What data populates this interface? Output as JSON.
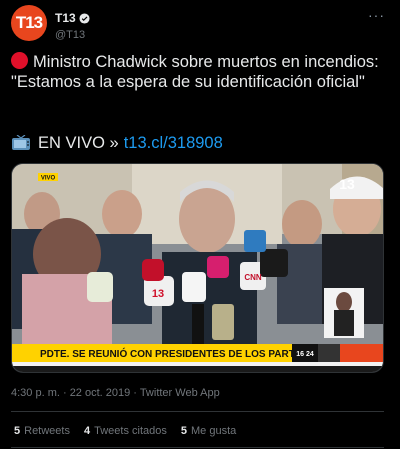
{
  "account": {
    "avatar_text": "T13",
    "display_name": "T13",
    "handle": "@T13",
    "brand_color": "#e8461e"
  },
  "tweet": {
    "text": "Ministro Chadwick sobre muertos en incendios: \"Estamos a la espera de su identificación oficial\"",
    "live_label": "EN VIVO »",
    "link": "t13.cl/318908"
  },
  "media": {
    "live_badge": "VIVO",
    "ticker": "PDTE. SE REUNIÓ CON PRESIDENTES DE LOS PARTIDOS",
    "ticker_time": "16 24",
    "mic_labels": [
      "13",
      "CNN"
    ],
    "channel_logo": "13"
  },
  "meta": {
    "timestamp": "4:30 p. m. · 22 oct. 2019 · Twitter Web App"
  },
  "stats": {
    "retweets_count": "5",
    "retweets_label": "Retweets",
    "quotes_count": "4",
    "quotes_label": "Tweets citados",
    "likes_count": "5",
    "likes_label": "Me gusta"
  }
}
